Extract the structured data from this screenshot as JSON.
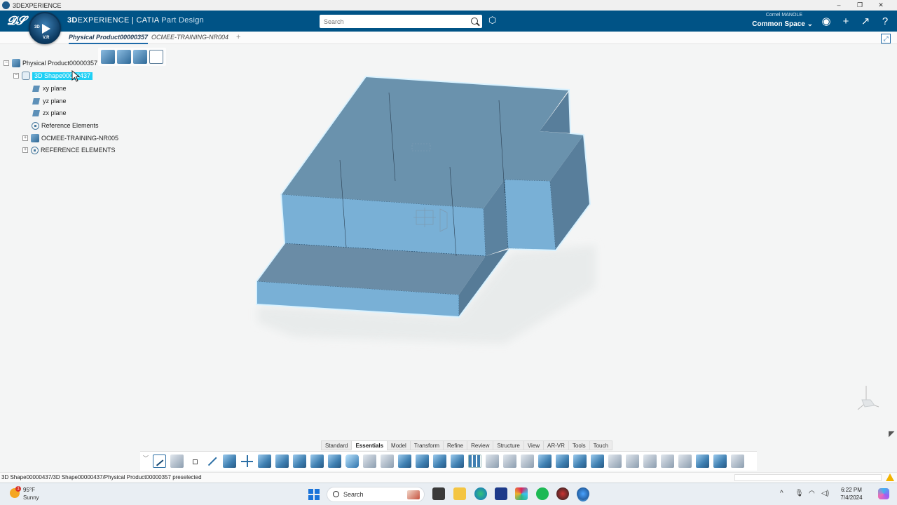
{
  "window": {
    "title": "3DEXPERIENCE",
    "controls": [
      "–",
      "❐",
      "✕"
    ]
  },
  "header": {
    "brand_bold": "3D",
    "brand_rest": "EXPERIENCE | CATIA",
    "app_name": "Part Design",
    "compass_labels": {
      "top": "3D",
      "bottom": "V.R"
    },
    "search_placeholder": "Search",
    "user_name": "Cornel MANOLE",
    "space": "Common Space",
    "space_chevron": "⌄"
  },
  "tabs": {
    "active": "Physical Product00000357",
    "second": "OCMEE-TRAINING-NR004",
    "add": "+"
  },
  "tree": {
    "root": "Physical Product00000357",
    "shape": "3D Shape00000437",
    "items": [
      "xy plane",
      "yz plane",
      "zx plane",
      "Reference Elements",
      "OCMEE-TRAINING-NR005",
      "REFERENCE ELEMENTS"
    ]
  },
  "action_sections": [
    "Standard",
    "Essentials",
    "Model",
    "Transform",
    "Refine",
    "Review",
    "Structure",
    "View",
    "AR-VR",
    "Tools",
    "Touch"
  ],
  "active_section": "Essentials",
  "status": {
    "text": "3D Shape00000437/3D Shape00000437/Physical Product00000357 preselected"
  },
  "taskbar": {
    "temperature": "95°F",
    "condition": "Sunny",
    "weather_badge": "1",
    "search": "Search",
    "time": "6:22 PM",
    "date": "7/4/2024",
    "tray_up": "^"
  },
  "colors": {
    "header": "#005386",
    "part_top": "#6a92ad",
    "part_front": "#78b0d6",
    "part_side": "#58809d",
    "selection": "#1fd0f5"
  }
}
